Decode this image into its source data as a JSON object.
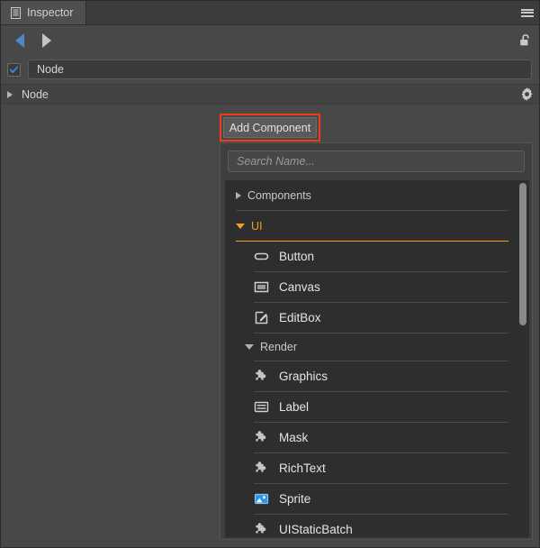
{
  "window": {
    "tab_label": "Inspector",
    "tab_icon": "inspector-document-icon",
    "menu_icon": "hamburger-menu-icon"
  },
  "nav": {
    "back_icon": "arrow-left-icon",
    "forward_icon": "arrow-right-icon",
    "lock_icon": "unlock-icon"
  },
  "node": {
    "enabled": true,
    "name_value": "Node",
    "component_label": "Node",
    "settings_icon": "gear-icon",
    "fold_icon": "chevron-right-icon"
  },
  "add_component": {
    "label": "Add Component",
    "highlight_color": "#f03a1b"
  },
  "dropdown": {
    "search": {
      "placeholder": "Search Name...",
      "value": ""
    },
    "groups": [
      {
        "label": "Components",
        "expanded": false,
        "highlight": false
      },
      {
        "label": "UI",
        "expanded": true,
        "highlight": true,
        "accent": "#f29f21"
      }
    ],
    "ui_items": [
      {
        "label": "Button",
        "icon": "capsule-button-icon"
      },
      {
        "label": "Canvas",
        "icon": "canvas-frame-icon"
      },
      {
        "label": "EditBox",
        "icon": "editbox-pencil-icon"
      }
    ],
    "render_group": {
      "label": "Render",
      "expanded": true
    },
    "render_items": [
      {
        "label": "Graphics",
        "icon": "puzzle-piece-icon"
      },
      {
        "label": "Label",
        "icon": "label-lines-icon"
      },
      {
        "label": "Mask",
        "icon": "puzzle-piece-icon"
      },
      {
        "label": "RichText",
        "icon": "puzzle-piece-icon"
      },
      {
        "label": "Sprite",
        "icon": "sprite-image-icon"
      },
      {
        "label": "UIStaticBatch",
        "icon": "puzzle-piece-icon"
      }
    ],
    "scrollbar": {
      "icon": "vertical-scrollbar"
    }
  }
}
